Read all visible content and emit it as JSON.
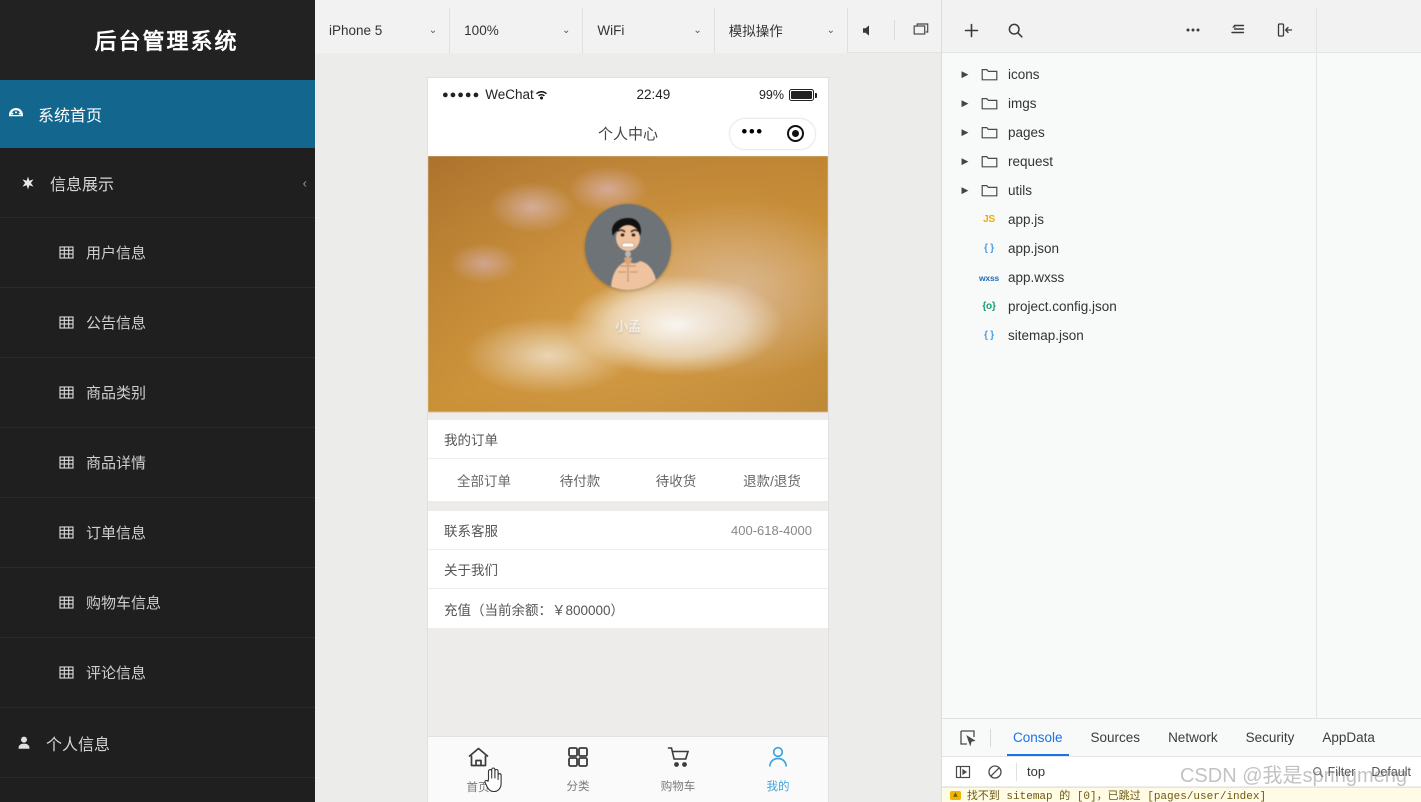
{
  "sidebar": {
    "title": "后台管理系统",
    "items": [
      {
        "label": "系统首页",
        "icon": "dashboard-icon",
        "type": "home",
        "active": true
      },
      {
        "label": "信息展示",
        "icon": "asterisk-icon",
        "type": "group",
        "collapse": "‹"
      },
      {
        "label": "用户信息",
        "icon": "table-icon",
        "type": "sub"
      },
      {
        "label": "公告信息",
        "icon": "table-icon",
        "type": "sub"
      },
      {
        "label": "商品类别",
        "icon": "table-icon",
        "type": "sub"
      },
      {
        "label": "商品详情",
        "icon": "table-icon",
        "type": "sub"
      },
      {
        "label": "订单信息",
        "icon": "table-icon",
        "type": "sub"
      },
      {
        "label": "购物车信息",
        "icon": "table-icon",
        "type": "sub"
      },
      {
        "label": "评论信息",
        "icon": "table-icon",
        "type": "sub"
      },
      {
        "label": "个人信息",
        "icon": "user-icon",
        "type": "bottom"
      }
    ],
    "accent_color": "#13678f",
    "background_color": "#1f1f1f"
  },
  "simulator_toolbar": {
    "device": "iPhone 5",
    "zoom": "100%",
    "network": "WiFi",
    "mode": "模拟操作",
    "caret": "⌄",
    "mute_icon": "speaker-mute-icon",
    "windows_icon": "multi-window-icon"
  },
  "phone": {
    "status_bar": {
      "signal_dots": "●●●●●",
      "carrier": "WeChat",
      "wifi_icon": "wifi-icon",
      "time": "22:49",
      "battery_percent": "99%"
    },
    "nav": {
      "title": "个人中心",
      "capsule_dots": "•••",
      "capsule_target_icon": "target-icon"
    },
    "banner": {
      "nickname": "小孟",
      "avatar_icon": "user-avatar-image"
    },
    "orders_card": {
      "header": "我的订单",
      "tabs": [
        "全部订单",
        "待付款",
        "待收货",
        "退款/退货"
      ]
    },
    "service_card": {
      "rows": [
        {
          "label": "联系客服",
          "value": "400-618-4000"
        },
        {
          "label": "关于我们",
          "value": ""
        },
        {
          "label": "充值（当前余额：￥800000）",
          "value": ""
        }
      ]
    },
    "tabbar": [
      {
        "label": "首页",
        "icon": "home-icon",
        "active": false
      },
      {
        "label": "分类",
        "icon": "grid-icon",
        "active": false
      },
      {
        "label": "购物车",
        "icon": "cart-icon",
        "active": false
      },
      {
        "label": "我的",
        "icon": "person-icon",
        "active": true
      }
    ],
    "tabbar_active_color": "#3aa6e0",
    "cursor_icon": "hand-cursor-icon"
  },
  "devtools_toolbar": {
    "add_icon": "plus-icon",
    "search_icon": "search-icon",
    "more_icon": "more-horizontal-icon",
    "outline_icon": "outline-list-icon",
    "panel_icon": "panel-collapse-icon"
  },
  "file_tree": [
    {
      "name": "icons",
      "type": "folder",
      "icon": "folder-icon",
      "expandable": true,
      "arrow": "▶"
    },
    {
      "name": "imgs",
      "type": "folder",
      "icon": "folder-icon",
      "expandable": true,
      "arrow": "▶"
    },
    {
      "name": "pages",
      "type": "folder",
      "icon": "folder-icon",
      "expandable": true,
      "arrow": "▶"
    },
    {
      "name": "request",
      "type": "folder",
      "icon": "folder-icon",
      "expandable": true,
      "arrow": "▶"
    },
    {
      "name": "utils",
      "type": "folder",
      "icon": "folder-icon",
      "expandable": true,
      "arrow": "▶"
    },
    {
      "name": "app.js",
      "type": "file",
      "icon": "js-file-icon",
      "badge": "JS",
      "badge_color": "#f0ab00",
      "expandable": false
    },
    {
      "name": "app.json",
      "type": "file",
      "icon": "json-file-icon",
      "badge": "{ }",
      "badge_color": "#4a9ee0",
      "expandable": false
    },
    {
      "name": "app.wxss",
      "type": "file",
      "icon": "wxss-file-icon",
      "badge": "wxss",
      "badge_color": "#1f6fb5",
      "expandable": false
    },
    {
      "name": "project.config.json",
      "type": "file",
      "icon": "config-file-icon",
      "badge": "{o}",
      "badge_color": "#18a06a",
      "expandable": false
    },
    {
      "name": "sitemap.json",
      "type": "file",
      "icon": "json-file-icon",
      "badge": "{ }",
      "badge_color": "#4a9ee0",
      "expandable": false
    }
  ],
  "devtools_panel": {
    "inspect_icon": "inspect-element-icon",
    "tabs": [
      {
        "label": "Console",
        "active": true
      },
      {
        "label": "Sources",
        "active": false
      },
      {
        "label": "Network",
        "active": false
      },
      {
        "label": "Security",
        "active": false
      },
      {
        "label": "AppData",
        "active": false
      }
    ],
    "active_tab_color": "#1a73e8",
    "console_bar": {
      "sidebar_icon": "console-sidebar-icon",
      "clear_icon": "clear-console-icon",
      "context": "top",
      "filter_placeholder": "Filter",
      "level": "Default"
    },
    "console_line": {
      "badge": "▲",
      "text": "找不到 sitemap 的 [0]，已跳过 [pages/user/index]"
    }
  },
  "watermark": "CSDN @我是springmeng"
}
